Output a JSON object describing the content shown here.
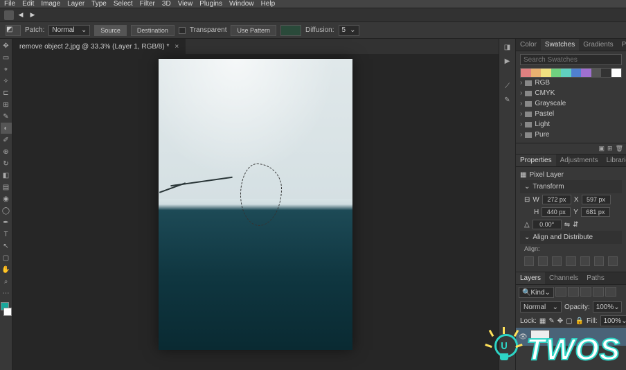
{
  "menu": {
    "items": [
      "File",
      "Edit",
      "Image",
      "Layer",
      "Type",
      "Select",
      "Filter",
      "3D",
      "View",
      "Plugins",
      "Window",
      "Help"
    ]
  },
  "options": {
    "patch_label": "Patch:",
    "patch_mode": "Normal",
    "source": "Source",
    "destination": "Destination",
    "transparent": "Transparent",
    "use_pattern": "Use Pattern",
    "diffusion_label": "Diffusion:",
    "diffusion_value": "5"
  },
  "tab": {
    "title": "remove object 2.jpg @ 33.3% (Layer 1, RGB/8) *"
  },
  "color_panel": {
    "tabs": [
      "Color",
      "Swatches",
      "Gradients",
      "Patterns"
    ],
    "active_tab": 1,
    "search_placeholder": "Search Swatches",
    "swatch_colors": [
      "#e08080",
      "#e8b070",
      "#f0e080",
      "#70d080",
      "#60d0c0",
      "#5080d0",
      "#a070d0",
      "#555555",
      "#333333",
      "#ffffff"
    ],
    "groups": [
      "RGB",
      "CMYK",
      "Grayscale",
      "Pastel",
      "Light",
      "Pure"
    ]
  },
  "props": {
    "tabs": [
      "Properties",
      "Adjustments",
      "Libraries"
    ],
    "active_tab": 0,
    "layer_kind": "Pixel Layer",
    "transform_label": "Transform",
    "w_label": "W",
    "w_value": "272 px",
    "h_label": "H",
    "h_value": "440 px",
    "x_label": "X",
    "x_value": "597 px",
    "y_label": "Y",
    "y_value": "681 px",
    "rotate_label": "△",
    "rotate_value": "0.00°",
    "align_label": "Align and Distribute",
    "align_sub": "Align:"
  },
  "layers": {
    "tabs": [
      "Layers",
      "Channels",
      "Paths"
    ],
    "active_tab": 0,
    "kind_label": "Kind",
    "blend_mode": "Normal",
    "opacity_label": "Opacity:",
    "opacity_value": "100%",
    "lock_label": "Lock:",
    "fill_label": "Fill:",
    "fill_value": "100%"
  },
  "overlay": {
    "logo_text": "TWOS"
  }
}
